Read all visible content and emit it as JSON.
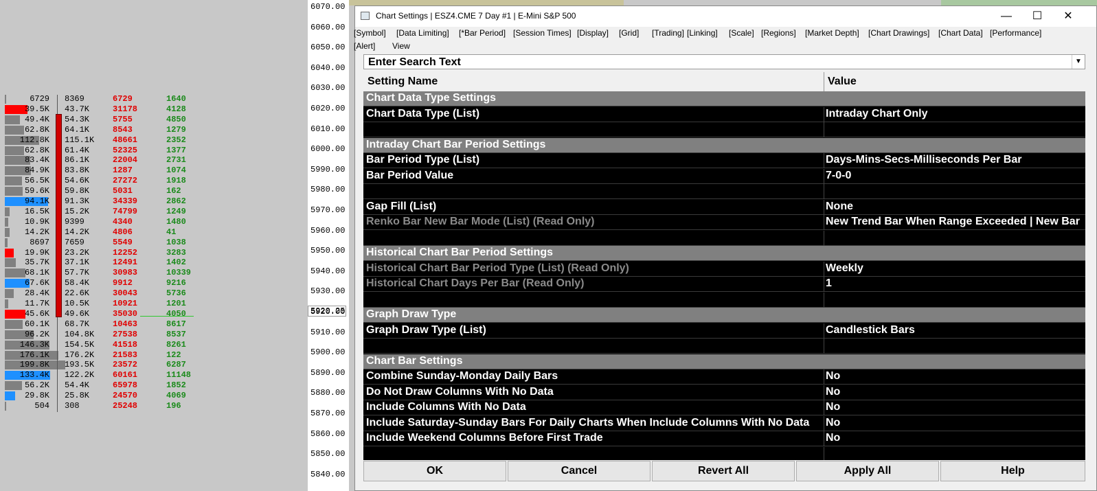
{
  "price_axis": {
    "ticks": [
      "6070.00",
      "6060.00",
      "6050.00",
      "6040.00",
      "6030.00",
      "6020.00",
      "6010.00",
      "6000.00",
      "5990.00",
      "5980.00",
      "5970.00",
      "5960.00",
      "5950.00",
      "5940.00",
      "5930.00",
      "5920.00",
      "5910.00",
      "5900.00",
      "5890.00",
      "5880.00",
      "5870.00",
      "5860.00",
      "5850.00",
      "5840.00"
    ],
    "current_price": "5920.25"
  },
  "volume_profile": [
    {
      "c1": "6729",
      "c2": "8369",
      "c3": "6729",
      "c4": "1640",
      "bar": "gray",
      "pct": 0.02
    },
    {
      "c1": "39.5K",
      "c2": "43.7K",
      "c3": "31178",
      "c4": "4128",
      "bar": "red",
      "pct": 0.5
    },
    {
      "c1": "49.4K",
      "c2": "54.3K",
      "c3": "5755",
      "c4": "4850",
      "bar": "gray",
      "pct": 0.33
    },
    {
      "c1": "62.8K",
      "c2": "64.1K",
      "c3": "8543",
      "c4": "1279",
      "bar": "gray",
      "pct": 0.42
    },
    {
      "c1": "112.8K",
      "c2": "115.1K",
      "c3": "48661",
      "c4": "2352",
      "bar": "gray",
      "pct": 0.75
    },
    {
      "c1": "62.8K",
      "c2": "61.4K",
      "c3": "52325",
      "c4": "1377",
      "bar": "gray",
      "pct": 0.42
    },
    {
      "c1": "83.4K",
      "c2": "86.1K",
      "c3": "22004",
      "c4": "2731",
      "bar": "gray",
      "pct": 0.56
    },
    {
      "c1": "84.9K",
      "c2": "83.8K",
      "c3": "1287",
      "c4": "1074",
      "bar": "gray",
      "pct": 0.57
    },
    {
      "c1": "56.5K",
      "c2": "54.6K",
      "c3": "27272",
      "c4": "1918",
      "bar": "gray",
      "pct": 0.38
    },
    {
      "c1": "59.6K",
      "c2": "59.8K",
      "c3": "5031",
      "c4": "162",
      "bar": "gray",
      "pct": 0.4
    },
    {
      "c1": "94.1K",
      "c2": "91.3K",
      "c3": "34339",
      "c4": "2862",
      "bar": "blue",
      "pct": 0.95
    },
    {
      "c1": "16.5K",
      "c2": "15.2K",
      "c3": "74799",
      "c4": "1249",
      "bar": "gray",
      "pct": 0.11
    },
    {
      "c1": "10.9K",
      "c2": "9399",
      "c3": "4340",
      "c4": "1480",
      "bar": "gray",
      "pct": 0.07
    },
    {
      "c1": "14.2K",
      "c2": "14.2K",
      "c3": "4806",
      "c4": "41",
      "bar": "gray",
      "pct": 0.1
    },
    {
      "c1": "8697",
      "c2": "7659",
      "c3": "5549",
      "c4": "1038",
      "bar": "gray",
      "pct": 0.06
    },
    {
      "c1": "19.9K",
      "c2": "23.2K",
      "c3": "12252",
      "c4": "3283",
      "bar": "red",
      "pct": 0.2
    },
    {
      "c1": "35.7K",
      "c2": "37.1K",
      "c3": "12491",
      "c4": "1402",
      "bar": "gray",
      "pct": 0.24
    },
    {
      "c1": "68.1K",
      "c2": "57.7K",
      "c3": "30983",
      "c4": "10339",
      "bar": "gray",
      "pct": 0.46
    },
    {
      "c1": "67.6K",
      "c2": "58.4K",
      "c3": "9912",
      "c4": "9216",
      "bar": "blue",
      "pct": 0.54
    },
    {
      "c1": "28.4K",
      "c2": "22.6K",
      "c3": "30043",
      "c4": "5736",
      "bar": "gray",
      "pct": 0.19
    },
    {
      "c1": "11.7K",
      "c2": "10.5K",
      "c3": "10921",
      "c4": "1201",
      "bar": "gray",
      "pct": 0.08
    },
    {
      "c1": "45.6K",
      "c2": "49.6K",
      "c3": "35030",
      "c4": "4050",
      "bar": "red",
      "pct": 0.46
    },
    {
      "c1": "60.1K",
      "c2": "68.7K",
      "c3": "10463",
      "c4": "8617",
      "bar": "gray",
      "pct": 0.4
    },
    {
      "c1": "96.2K",
      "c2": "104.8K",
      "c3": "27538",
      "c4": "8537",
      "bar": "gray",
      "pct": 0.64
    },
    {
      "c1": "146.3K",
      "c2": "154.5K",
      "c3": "41518",
      "c4": "8261",
      "bar": "gray",
      "pct": 0.98
    },
    {
      "c1": "176.1K",
      "c2": "176.2K",
      "c3": "21583",
      "c4": "122",
      "bar": "gray",
      "pct": 1.18
    },
    {
      "c1": "199.8K",
      "c2": "193.5K",
      "c3": "23572",
      "c4": "6287",
      "bar": "gray",
      "pct": 1.34
    },
    {
      "c1": "133.4K",
      "c2": "122.2K",
      "c3": "60161",
      "c4": "11148",
      "bar": "blue",
      "pct": 1.0
    },
    {
      "c1": "56.2K",
      "c2": "54.4K",
      "c3": "65978",
      "c4": "1852",
      "bar": "gray",
      "pct": 0.38
    },
    {
      "c1": "29.8K",
      "c2": "25.8K",
      "c3": "24570",
      "c4": "4069",
      "bar": "blue",
      "pct": 0.22
    },
    {
      "c1": "504",
      "c2": "308",
      "c3": "25248",
      "c4": "196",
      "bar": "gray",
      "pct": 0.01
    }
  ],
  "dialog": {
    "title": "Chart Settings | ESZ4.CME  7 Day  #1 | E-Mini S&P 500",
    "window_buttons": {
      "minimize": "—",
      "maximize": "☐",
      "close": "✕"
    },
    "menu": [
      "[Symbol]",
      "[Data Limiting]",
      "[*Bar Period]",
      "[Session Times]",
      "[Display]",
      "[Grid]",
      "[Trading]",
      "[Linking]",
      "[Scale]",
      "[Regions]",
      "[Market Depth]",
      "[Chart Drawings]",
      "[Chart Data]",
      "[Performance]",
      "[Alert]",
      "View"
    ],
    "search_placeholder": "Enter Search Text",
    "columns": {
      "name": "Setting Name",
      "value": "Value"
    },
    "rows": [
      {
        "type": "section",
        "name": "Chart Data Type Settings",
        "value": ""
      },
      {
        "type": "row",
        "name": "Chart Data Type (List)",
        "value": "Intraday Chart Only"
      },
      {
        "type": "blank",
        "name": "",
        "value": ""
      },
      {
        "type": "section",
        "name": "Intraday Chart Bar Period Settings",
        "value": ""
      },
      {
        "type": "row",
        "name": "Bar Period Type (List)",
        "value": "Days-Mins-Secs-Milliseconds Per Bar"
      },
      {
        "type": "row",
        "name": "Bar Period Value",
        "value": "7-0-0"
      },
      {
        "type": "blank",
        "name": "",
        "value": ""
      },
      {
        "type": "row",
        "name": "Gap Fill (List)",
        "value": "None"
      },
      {
        "type": "ro",
        "name": "Renko Bar New Bar Mode (List) (Read Only)",
        "value": "New Trend Bar When Range Exceeded | New Bar"
      },
      {
        "type": "blank",
        "name": "",
        "value": ""
      },
      {
        "type": "section",
        "name": "Historical Chart Bar Period Settings",
        "value": ""
      },
      {
        "type": "ro",
        "name": "Historical Chart Bar Period Type (List) (Read Only)",
        "value": "Weekly"
      },
      {
        "type": "ro",
        "name": "Historical Chart Days Per Bar (Read Only)",
        "value": "1"
      },
      {
        "type": "blank",
        "name": "",
        "value": ""
      },
      {
        "type": "section",
        "name": "Graph Draw Type",
        "value": ""
      },
      {
        "type": "row",
        "name": "Graph Draw Type (List)",
        "value": "Candlestick Bars"
      },
      {
        "type": "blank",
        "name": "",
        "value": ""
      },
      {
        "type": "section",
        "name": "Chart Bar Settings",
        "value": ""
      },
      {
        "type": "row",
        "name": "Combine Sunday-Monday Daily Bars",
        "value": "No"
      },
      {
        "type": "row",
        "name": "Do Not Draw Columns With No Data",
        "value": "No"
      },
      {
        "type": "row",
        "name": "Include Columns With No Data",
        "value": "No"
      },
      {
        "type": "row",
        "name": "Include Saturday-Sunday Bars For Daily Charts When Include Columns With No Data",
        "value": "No"
      },
      {
        "type": "row",
        "name": "Include Weekend Columns Before First Trade",
        "value": "No"
      },
      {
        "type": "blank",
        "name": "",
        "value": ""
      }
    ],
    "buttons": [
      "OK",
      "Cancel",
      "Revert All",
      "Apply All",
      "Help"
    ]
  },
  "colors": {
    "bar_gray": "#808080",
    "bar_red": "#ff0000",
    "bar_blue": "#1e90ff",
    "section_bg": "#808080",
    "grid_bg": "#000000"
  }
}
